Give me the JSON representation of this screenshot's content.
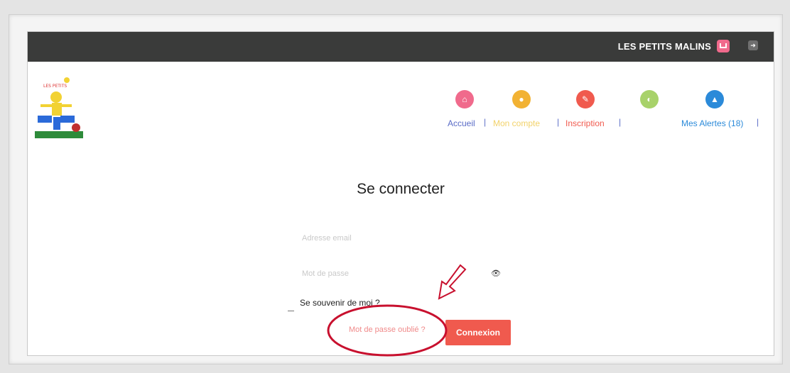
{
  "header": {
    "brand": "LES PETITS MALINS",
    "cart_icon": "cart-icon",
    "logout_icon": "logout-icon"
  },
  "nav": {
    "items": [
      {
        "label": "Accueil",
        "icon": "home-icon",
        "color": "#f06a8c"
      },
      {
        "label": "Mon compte",
        "icon": "user-icon",
        "color": "#f2b233"
      },
      {
        "label": "Inscription",
        "icon": "pencil-icon",
        "color": "#f05a4e"
      },
      {
        "label": "",
        "icon": "moon-icon",
        "color": "#a8d26a"
      },
      {
        "label": "Mes Alertes (18)",
        "icon": "alert-icon",
        "color": "#2b8ad9"
      }
    ],
    "separator": "|"
  },
  "login": {
    "title": "Se connecter",
    "email_placeholder": "Adresse email",
    "password_placeholder": "Mot de passe",
    "remember_label": "Se souvenir de moi ?",
    "forgot_link": "Mot de passe oublié ?",
    "submit_label": "Connexion"
  },
  "logo_text": "LES PETITS",
  "colors": {
    "topbar": "#3a3b3a",
    "accent": "#f05a4e",
    "annotation": "#c8102e"
  }
}
